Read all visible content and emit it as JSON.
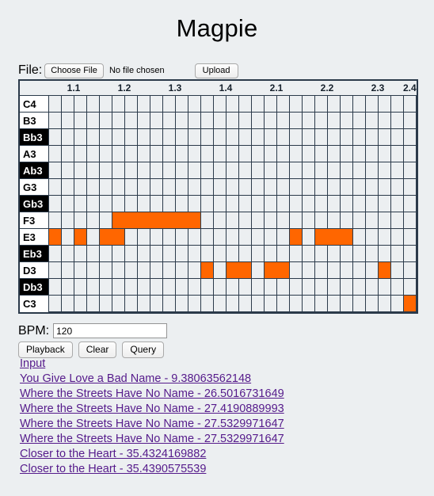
{
  "app": {
    "title": "Magpie"
  },
  "file_row": {
    "label": "File:",
    "choose_button": "Choose File",
    "status": "No file chosen",
    "upload_button": "Upload"
  },
  "grid": {
    "beat_labels": [
      "1.1",
      "1.2",
      "1.3",
      "1.4",
      "2.1",
      "2.2",
      "2.3",
      "2.4"
    ],
    "columns": 29,
    "label_every": 4,
    "accent_color": "#ff6600",
    "grid_line_color": "#2b3a4a",
    "cell_color": "#eceff1",
    "rows": [
      {
        "name": "C4",
        "accidental": false,
        "notes": []
      },
      {
        "name": "B3",
        "accidental": false,
        "notes": []
      },
      {
        "name": "Bb3",
        "accidental": true,
        "notes": []
      },
      {
        "name": "A3",
        "accidental": false,
        "notes": []
      },
      {
        "name": "Ab3",
        "accidental": true,
        "notes": []
      },
      {
        "name": "G3",
        "accidental": false,
        "notes": []
      },
      {
        "name": "Gb3",
        "accidental": true,
        "notes": []
      },
      {
        "name": "F3",
        "accidental": false,
        "notes": [
          {
            "start": 5,
            "length": 7
          }
        ]
      },
      {
        "name": "E3",
        "accidental": false,
        "notes": [
          {
            "start": 0,
            "length": 1
          },
          {
            "start": 2,
            "length": 1
          },
          {
            "start": 4,
            "length": 2
          },
          {
            "start": 19,
            "length": 1
          },
          {
            "start": 21,
            "length": 3
          }
        ]
      },
      {
        "name": "Eb3",
        "accidental": true,
        "notes": []
      },
      {
        "name": "D3",
        "accidental": false,
        "notes": [
          {
            "start": 12,
            "length": 1
          },
          {
            "start": 14,
            "length": 2
          },
          {
            "start": 17,
            "length": 2
          },
          {
            "start": 26,
            "length": 1
          }
        ]
      },
      {
        "name": "Db3",
        "accidental": true,
        "notes": []
      },
      {
        "name": "C3",
        "accidental": false,
        "notes": [
          {
            "start": 28,
            "length": 1
          }
        ]
      }
    ]
  },
  "bpm": {
    "label": "BPM:",
    "value": "120"
  },
  "controls": {
    "playback": "Playback",
    "clear": "Clear",
    "query": "Query"
  },
  "results": {
    "heading_link": "Input",
    "items": [
      "You Give Love a Bad Name - 9.38063562148",
      "Where the Streets Have No Name - 26.5016731649",
      "Where the Streets Have No Name - 27.4190889993",
      "Where the Streets Have No Name - 27.5329971647",
      "Where the Streets Have No Name - 27.5329971647",
      "Closer to the Heart - 35.4324169882",
      "Closer to the Heart - 35.4390575539"
    ],
    "link_color": "#551a8b"
  }
}
